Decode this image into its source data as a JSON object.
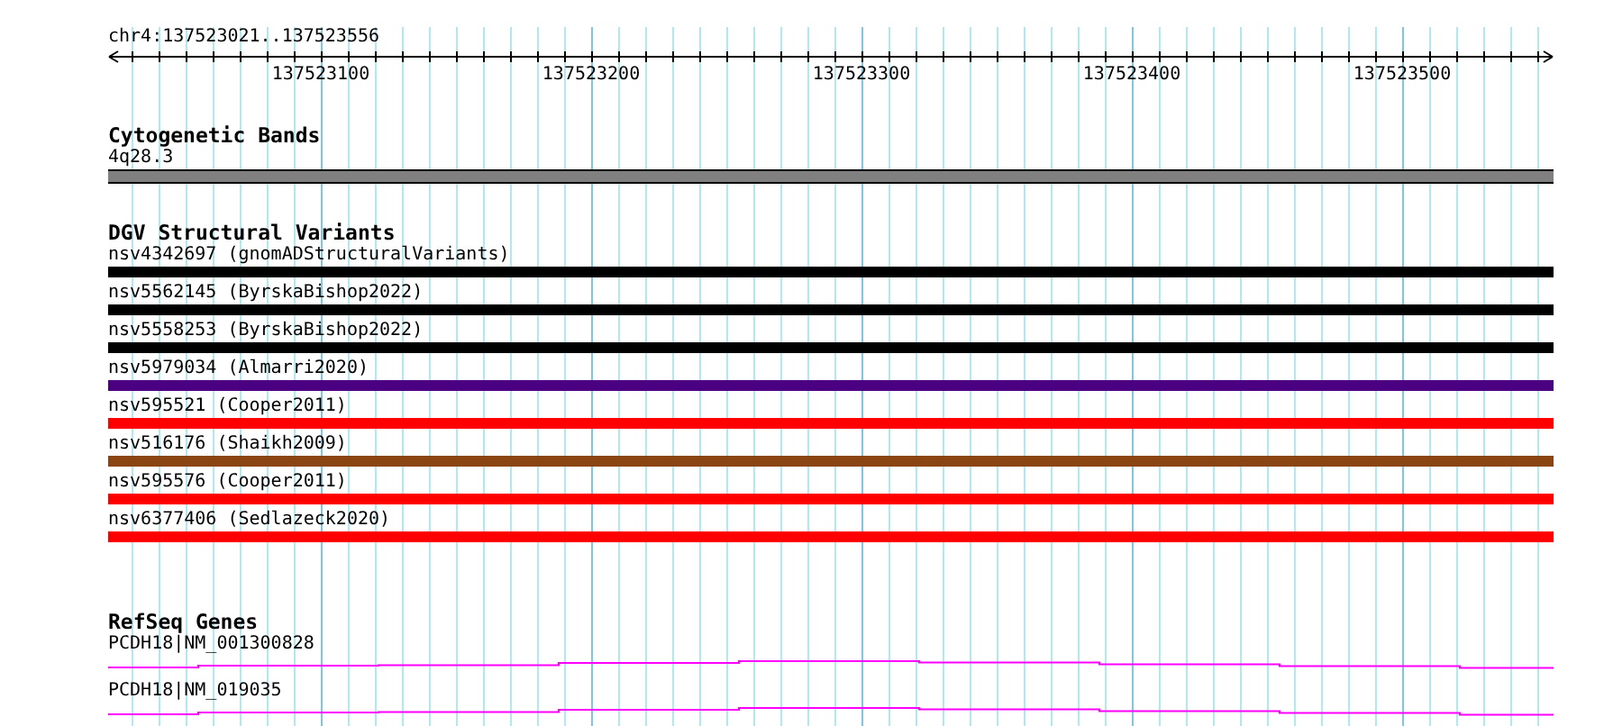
{
  "ruler": {
    "location": "chr4:137523021..137523556",
    "tick_labels": [
      "137523100",
      "137523200",
      "137523300",
      "137523400",
      "137523500"
    ]
  },
  "tracks": [
    {
      "kind": "cytoband",
      "title": "Cytogenetic Bands",
      "items": [
        {
          "label": "4q28.3"
        }
      ]
    },
    {
      "kind": "variants",
      "title": "DGV Structural Variants",
      "items": [
        {
          "label": "nsv4342697 (gnomADStructuralVariants)",
          "color": "#000000"
        },
        {
          "label": "nsv5562145 (ByrskaBishop2022)",
          "color": "#000000"
        },
        {
          "label": "nsv5558253 (ByrskaBishop2022)",
          "color": "#000000"
        },
        {
          "label": "nsv5979034 (Almarri2020)",
          "color": "#4b0082"
        },
        {
          "label": "nsv595521 (Cooper2011)",
          "color": "#ff0000"
        },
        {
          "label": "nsv516176 (Shaikh2009)",
          "color": "#8b4513"
        },
        {
          "label": "nsv595576 (Cooper2011)",
          "color": "#ff0000"
        },
        {
          "label": "nsv6377406 (Sedlazeck2020)",
          "color": "#ff0000"
        }
      ]
    },
    {
      "kind": "genes",
      "title": "RefSeq Genes",
      "items": [
        {
          "label": "PCDH18|NM_001300828"
        },
        {
          "label": "PCDH18|NM_019035"
        }
      ]
    }
  ]
}
